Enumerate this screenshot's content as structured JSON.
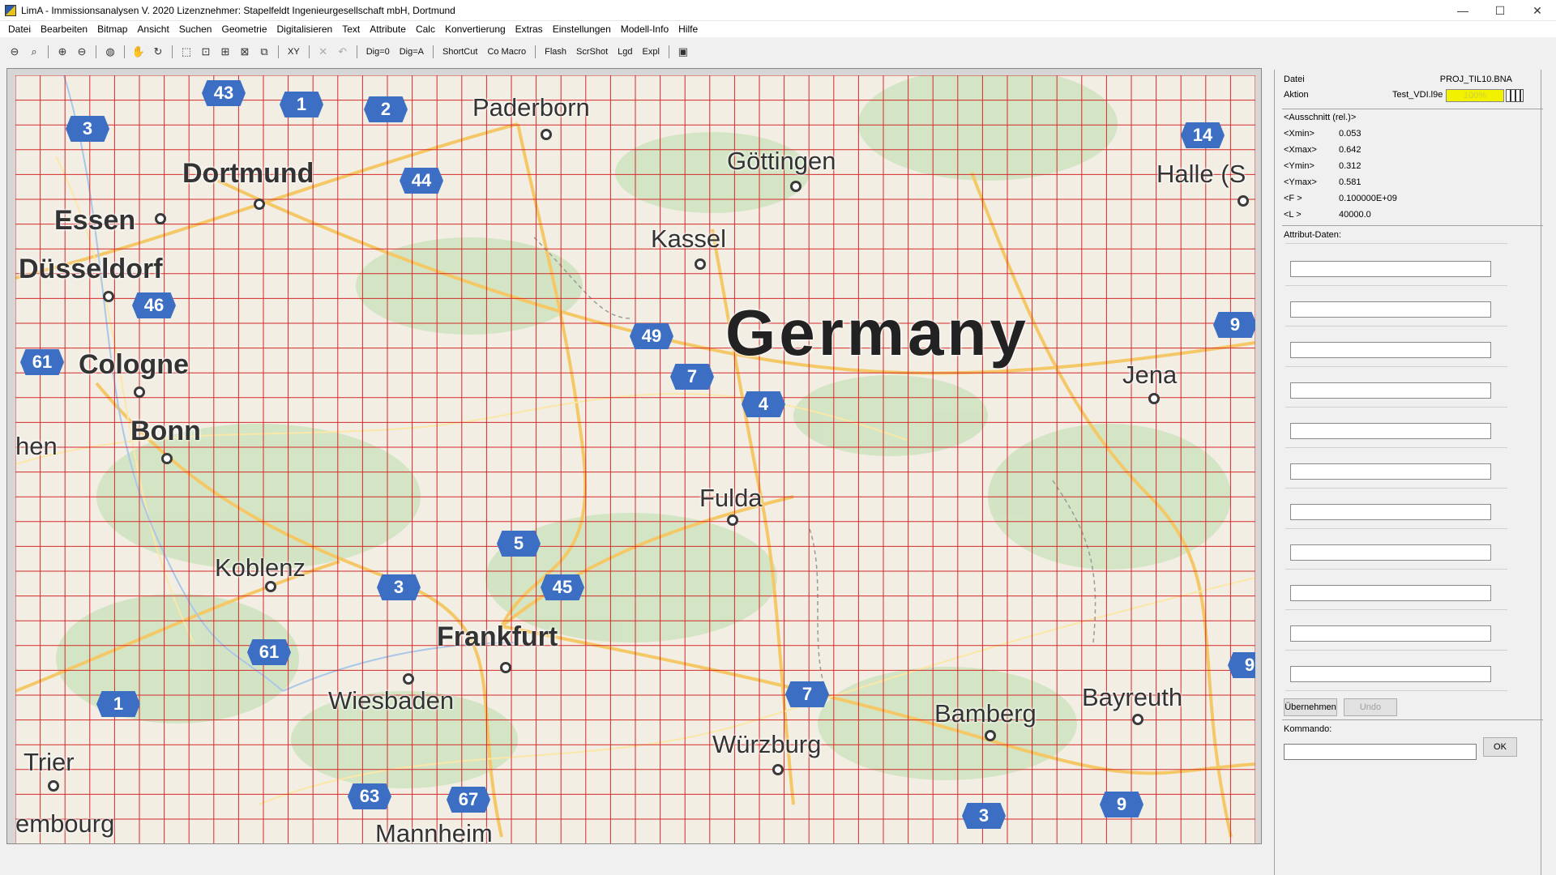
{
  "window": {
    "title": "LimA - Immissionsanalysen     V. 2020     Lizenznehmer: Stapelfeldt Ingenieurgesellschaft mbH, Dortmund",
    "minimize": "—",
    "maximize": "☐",
    "close": "✕"
  },
  "menu": [
    "Datei",
    "Bearbeiten",
    "Bitmap",
    "Ansicht",
    "Suchen",
    "Geometrie",
    "Digitalisieren",
    "Text",
    "Attribute",
    "Calc",
    "Konvertierung",
    "Extras",
    "Einstellungen",
    "Modell-Info",
    "Hilfe"
  ],
  "toolbar": {
    "xy": "XY",
    "dig0": "Dig=0",
    "diga": "Dig=A",
    "shortcut": "ShortCut",
    "comacro": "Co Macro",
    "flash": "Flash",
    "scrshot": "ScrShot",
    "lgd": "Lgd",
    "expl": "Expl"
  },
  "map": {
    "country_label": "Germany",
    "cities": [
      {
        "name": "Paderborn",
        "size": "m"
      },
      {
        "name": "Dortmund",
        "size": "l"
      },
      {
        "name": "Essen",
        "size": "l"
      },
      {
        "name": "Göttingen",
        "size": "m"
      },
      {
        "name": "Kassel",
        "size": "m"
      },
      {
        "name": "Halle (S",
        "size": "m"
      },
      {
        "name": "Düsseldorf",
        "size": "l"
      },
      {
        "name": "Cologne",
        "size": "l"
      },
      {
        "name": "Jena",
        "size": "m"
      },
      {
        "name": "Bonn",
        "size": "l"
      },
      {
        "name": "hen",
        "size": "m"
      },
      {
        "name": "Fulda",
        "size": "m"
      },
      {
        "name": "Koblenz",
        "size": "m"
      },
      {
        "name": "Frankfurt",
        "size": "l"
      },
      {
        "name": "Wiesbaden",
        "size": "m"
      },
      {
        "name": "Bamberg",
        "size": "m"
      },
      {
        "name": "Bayreuth",
        "size": "m"
      },
      {
        "name": "Würzburg",
        "size": "m"
      },
      {
        "name": "Trier",
        "size": "m"
      },
      {
        "name": "embourg",
        "size": "m"
      },
      {
        "name": "Mannheim",
        "size": "m"
      }
    ],
    "highway_shields": [
      "43",
      "1",
      "2",
      "3",
      "44",
      "14",
      "46",
      "49",
      "9",
      "61",
      "7",
      "4",
      "5",
      "3",
      "45",
      "61",
      "9",
      "1",
      "7",
      "63",
      "67",
      "3",
      "9"
    ],
    "grid_color": "#d42a2a"
  },
  "panel": {
    "datei_label": "Datei",
    "datei_value": "PROJ_TIL10.BNA",
    "aktion_label": "Aktion",
    "aktion_value": "Test_VDI.l9e",
    "progress_text": "100%",
    "ausschnitt_title": "<Ausschnitt (rel.)>",
    "params": [
      {
        "key": "<Xmin>",
        "value": "0.053"
      },
      {
        "key": "<Xmax>",
        "value": "0.642"
      },
      {
        "key": "<Ymin>",
        "value": "0.312"
      },
      {
        "key": "<Ymax>",
        "value": "0.581"
      },
      {
        "key": "<F >",
        "value": "0.100000E+09"
      },
      {
        "key": "<L >",
        "value": "40000.0"
      }
    ],
    "attribut_title": "Attribut-Daten:",
    "attribut_fields": [
      "",
      "",
      "",
      "",
      "",
      "",
      "",
      "",
      "",
      "",
      ""
    ],
    "uebernehmen": "Übernehmen",
    "undo": "Undo",
    "kommando_label": "Kommando:",
    "ok": "OK"
  }
}
